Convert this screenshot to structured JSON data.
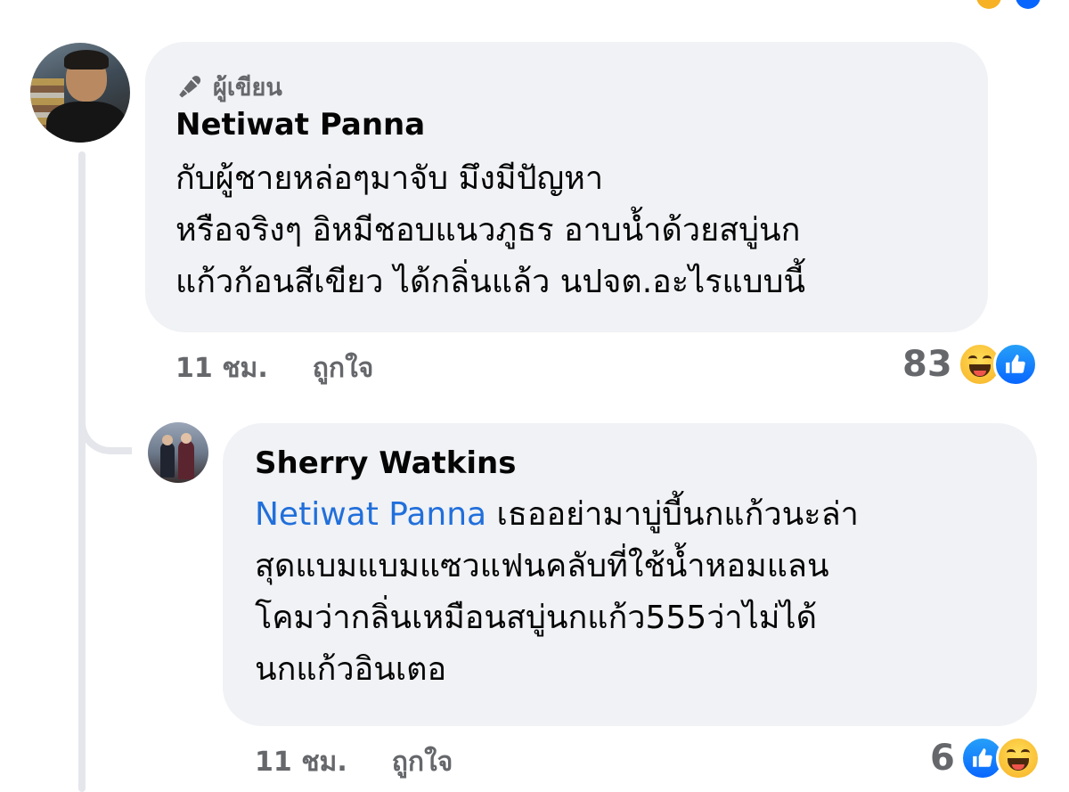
{
  "colors": {
    "bubble": "#f0f2f5",
    "mention": "#216fdb",
    "meta_text": "#65676b",
    "haha_yellow": "#f7b125",
    "like_blue": "#0866ff"
  },
  "comments": [
    {
      "author_badge": "ผู้เขียน",
      "author_badge_icon": "microphone-icon",
      "name": "Netiwat Panna",
      "lines": "กับผู้ชายหล่อๆมาจับ มึงมีปัญหา\nหรือจริงๆ อิหมีชอบแนวภูธร อาบน้ำด้วยสบู่นก\nแก้วก้อนสีเขียว ได้กลิ่นแล้ว นปจต.อะไรแบบนี้",
      "time": "11 ชม.",
      "like_label": "ถูกใจ",
      "reaction_count": "83",
      "reactions": [
        "haha-icon",
        "like-icon"
      ]
    },
    {
      "name": "Sherry Watkins",
      "mention": "Netiwat Panna",
      "lines": " เธออย่ามาบู่บี้นกแก้วนะล่า\nสุดแบมแบมแซวแฟนคลับที่ใช้น้ำหอมแลน\nโคมว่ากลิ่นเหมือนสบู่นกแก้ว555ว่าไม่ได้\nนกแก้วอินเตอ",
      "time": "11 ชม.",
      "like_label": "ถูกใจ",
      "reaction_count": "6",
      "reactions": [
        "like-icon",
        "haha-icon"
      ]
    }
  ]
}
